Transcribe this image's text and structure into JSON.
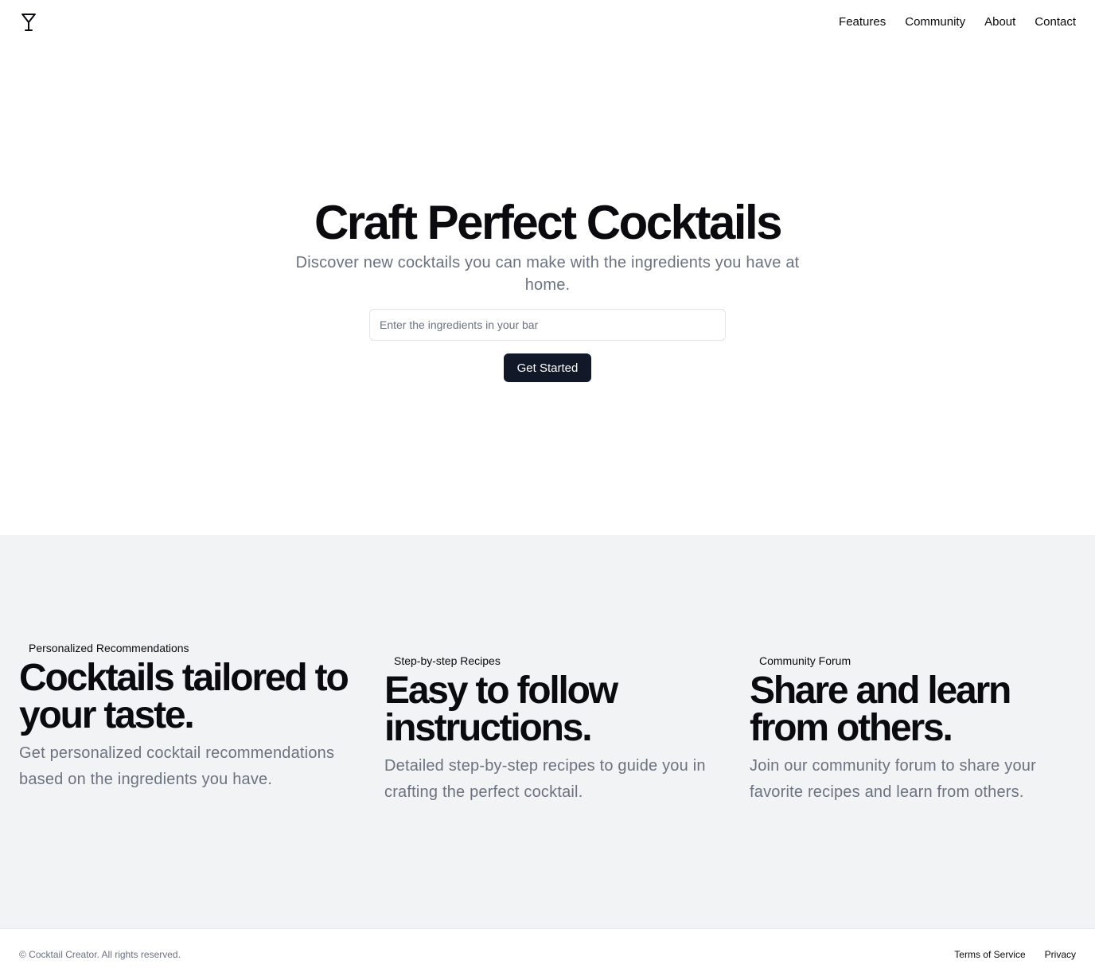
{
  "header": {
    "logo_icon": "martini-glass-icon",
    "nav": [
      "Features",
      "Community",
      "About",
      "Contact"
    ]
  },
  "hero": {
    "title": "Craft Perfect Cocktails",
    "subtitle": "Discover new cocktails you can make with the ingredients you have at home.",
    "search_placeholder": "Enter the ingredients in your bar",
    "cta_label": "Get Started"
  },
  "features": [
    {
      "badge": "Personalized Recommendations",
      "title": "Cocktails tailored to your taste.",
      "description": "Get personalized cocktail recommendations based on the ingredients you have."
    },
    {
      "badge": "Step-by-step Recipes",
      "title": "Easy to follow instructions.",
      "description": "Detailed step-by-step recipes to guide you in crafting the perfect cocktail."
    },
    {
      "badge": "Community Forum",
      "title": "Share and learn from others.",
      "description": "Join our community forum to share your favorite recipes and learn from others."
    }
  ],
  "footer": {
    "copyright": "© Cocktail Creator. All rights reserved.",
    "links": [
      "Terms of Service",
      "Privacy"
    ]
  },
  "colors": {
    "primary_button": "#111827",
    "feature_section_bg": "#f2f3f4",
    "muted_text": "#6b7280"
  }
}
